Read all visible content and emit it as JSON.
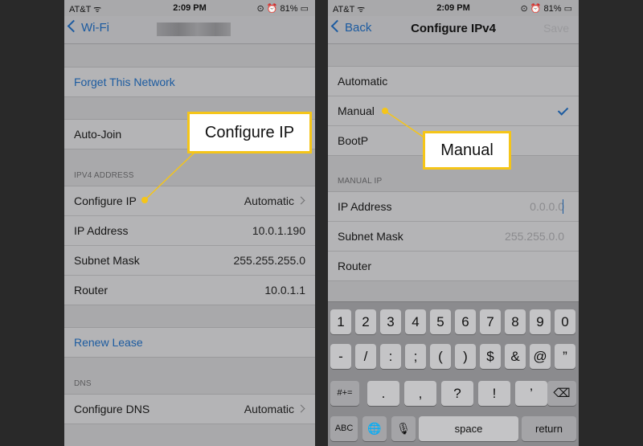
{
  "left": {
    "status": {
      "carrier": "AT&T ᯤ",
      "time": "2:09 PM",
      "right": "⊙ ⏰ 81% ▭"
    },
    "back_label": "Wi-Fi",
    "rows": {
      "forget": "Forget This Network",
      "auto_join": "Auto-Join",
      "ipv4_header": "IPV4 ADDRESS",
      "configure_ip": {
        "label": "Configure IP",
        "value": "Automatic"
      },
      "ip_address": {
        "label": "IP Address",
        "value": "10.0.1.190"
      },
      "subnet_mask": {
        "label": "Subnet Mask",
        "value": "255.255.255.0"
      },
      "router": {
        "label": "Router",
        "value": "10.0.1.1"
      },
      "renew": "Renew Lease",
      "dns_header": "DNS",
      "configure_dns": {
        "label": "Configure DNS",
        "value": "Automatic"
      }
    },
    "callout": "Configure IP"
  },
  "right": {
    "status": {
      "carrier": "AT&T ᯤ",
      "time": "2:09 PM",
      "right": "⊙ ⏰ 81% ▭"
    },
    "back_label": "Back",
    "title": "Configure IPv4",
    "save_label": "Save",
    "options": [
      "Automatic",
      "Manual",
      "BootP"
    ],
    "manual_header": "MANUAL IP",
    "ip_address": {
      "label": "IP Address",
      "placeholder": "0.0.0.0"
    },
    "subnet_mask": {
      "label": "Subnet Mask",
      "placeholder": "255.255.0.0"
    },
    "router": {
      "label": "Router"
    },
    "callout": "Manual",
    "keyboard": {
      "row1": [
        "1",
        "2",
        "3",
        "4",
        "5",
        "6",
        "7",
        "8",
        "9",
        "0"
      ],
      "row2": [
        "-",
        "/",
        ":",
        ";",
        "(",
        ")",
        "$",
        "&",
        "@",
        "”"
      ],
      "row3_switch": "#+=",
      "row3": [
        ".",
        ",",
        "?",
        "!",
        "’"
      ],
      "backspace": "⌫",
      "abc": "ABC",
      "globe": "🌐",
      "mic": "🎙",
      "space": "space",
      "return": "return"
    }
  },
  "colors": {
    "callout_border": "#f5c518",
    "link_blue": "#1c5ba0"
  }
}
